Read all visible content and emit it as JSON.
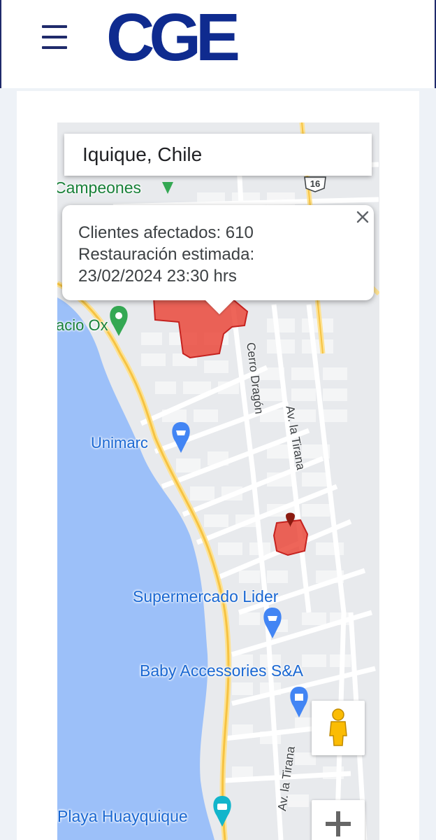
{
  "header": {
    "menu_icon": "hamburger-menu-icon",
    "logo_text": "CGE",
    "brand_color": "#0f2b8f"
  },
  "map": {
    "search_value": "Iquique, Chile",
    "popup": {
      "line1": "Clientes afectados: 610",
      "line2": "Restauración estimada:",
      "line3": "23/02/2024 23:30 hrs"
    },
    "labels": {
      "campeones": "Campeones",
      "palacio": "acio Ox",
      "unimarc": "Unimarc",
      "lider": "Supermercado Lider",
      "baby": "Baby Accessories S&A",
      "playa": "Playa Huayquique",
      "cerro": "Cerro Dragón",
      "tirana1": "Av. la Tirana",
      "tirana2": "Av. la Tirana",
      "highway": "16"
    },
    "outage_color": "#ea4335",
    "water_color": "#9cc0f9"
  }
}
